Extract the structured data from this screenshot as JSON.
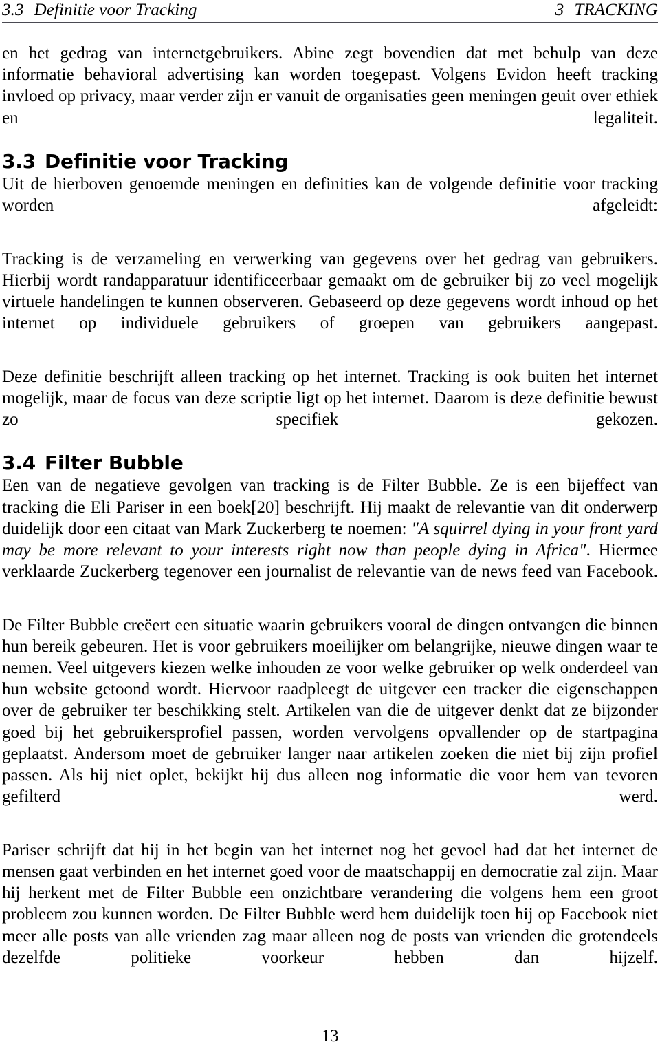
{
  "running_header": {
    "left_number": "3.3",
    "left_title": "Definitie voor Tracking",
    "right_number": "3",
    "right_title": "TRACKING"
  },
  "paragraphs": {
    "intro": "en het gedrag van internetgebruikers. Abine zegt bovendien dat met behulp van deze informatie behavioral advertising kan worden toegepast. Volgens Evidon heeft tracking invloed op privacy, maar verder zijn er vanuit de organisaties geen meningen geuit over ethiek en legaliteit.",
    "lead_in": "Uit de hierboven genoemde meningen en definities kan de volgende definitie voor tracking worden afgeleidt:",
    "definition": "Tracking is de verzameling en verwerking van gegevens over het gedrag van gebruikers. Hierbij wordt randapparatuur identificeerbaar gemaakt om de gebruiker bij zo veel mogelijk virtuele handelingen te kunnen observeren. Gebaseerd op deze gegevens wordt inhoud op het internet op individuele gebruikers of groepen van gebruikers aangepast.",
    "definition_scope": "Deze definitie beschrijft alleen tracking op het internet. Tracking is ook buiten het internet mogelijk, maar de focus van deze scriptie ligt op het internet. Daarom is deze definitie bewust zo specifiek gekozen.",
    "bubble_intro_before_quote": "Een van de negatieve gevolgen van tracking is de Filter Bubble. Ze is een bijeffect van tracking die Eli Pariser in een boek[20] beschrijft. Hij maakt de relevantie van dit onderwerp duidelijk door een citaat van Mark Zuckerberg te noemen: ",
    "zuckerberg_quote": "\"A squirrel dying in your front yard may be more relevant to your interests right now than people dying in Africa\"",
    "bubble_intro_after_quote": ". Hiermee verklaarde Zuckerberg tegenover een journalist de relevantie van de news feed van Facebook.",
    "bubble_effects": "De Filter Bubble creëert een situatie waarin gebruikers vooral de dingen ontvangen die binnen hun bereik gebeuren. Het is voor gebruikers moeilijker om belangrijke, nieuwe dingen waar te nemen. Veel uitgevers kiezen welke inhouden ze voor welke gebruiker op welk onderdeel van hun website getoond wordt. Hiervoor raadpleegt de uitgever een tracker die eigenschappen over de gebruiker ter beschikking stelt. Artikelen van die de uitgever denkt dat ze bijzonder goed bij het gebruikersprofiel passen, worden vervolgens opvallender op de startpagina geplaatst. Andersom moet de gebruiker langer naar artikelen zoeken die niet bij zijn profiel passen. Als hij niet oplet, bekijkt hij dus alleen nog informatie die voor hem van tevoren gefilterd werd.",
    "pariser": "Pariser schrijft dat hij in het begin van het internet nog het gevoel had dat het internet de mensen gaat verbinden en het internet goed voor de maatschappij en democratie zal zijn. Maar hij herkent met de Filter Bubble een onzichtbare verandering die volgens hem een groot probleem zou kunnen worden. De Filter Bubble werd hem duidelijk toen hij op Facebook niet meer alle posts van alle vrienden zag maar alleen nog de posts van vrienden die grotendeels dezelfde politieke voorkeur hebben dan hijzelf."
  },
  "sections": {
    "s33_number": "3.3",
    "s33_title": "Definitie voor Tracking",
    "s34_number": "3.4",
    "s34_title": "Filter Bubble"
  },
  "footer": {
    "page_number": "13"
  }
}
